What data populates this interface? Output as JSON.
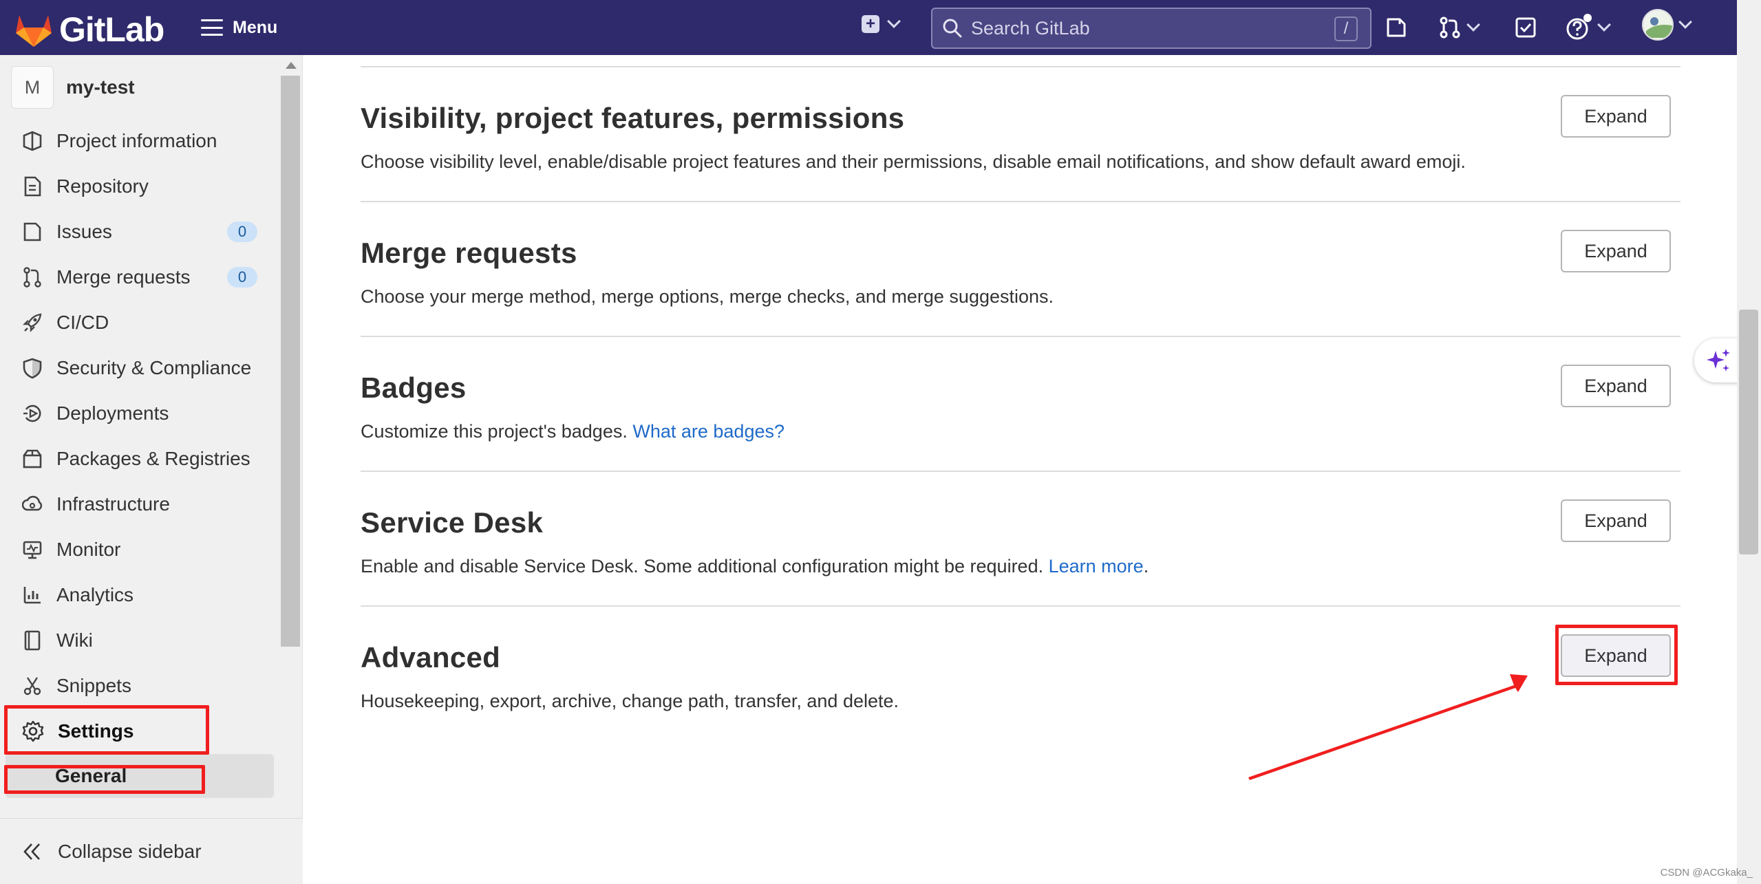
{
  "topbar": {
    "brand": "GitLab",
    "menu_label": "Menu",
    "search_placeholder": "Search GitLab",
    "search_shortcut": "/"
  },
  "sidebar": {
    "project_initial": "M",
    "project_name": "my-test",
    "items": [
      {
        "label": "Project information",
        "icon": "project-information-icon"
      },
      {
        "label": "Repository",
        "icon": "repository-icon"
      },
      {
        "label": "Issues",
        "icon": "issues-icon",
        "count": "0"
      },
      {
        "label": "Merge requests",
        "icon": "merge-requests-icon",
        "count": "0"
      },
      {
        "label": "CI/CD",
        "icon": "rocket-icon"
      },
      {
        "label": "Security & Compliance",
        "icon": "shield-icon"
      },
      {
        "label": "Deployments",
        "icon": "deployments-icon"
      },
      {
        "label": "Packages & Registries",
        "icon": "package-icon"
      },
      {
        "label": "Infrastructure",
        "icon": "infrastructure-icon"
      },
      {
        "label": "Monitor",
        "icon": "monitor-icon"
      },
      {
        "label": "Analytics",
        "icon": "analytics-icon"
      },
      {
        "label": "Wiki",
        "icon": "wiki-icon"
      },
      {
        "label": "Snippets",
        "icon": "snippets-icon"
      },
      {
        "label": "Settings",
        "icon": "gear-icon"
      }
    ],
    "sub_item": "General",
    "collapse_label": "Collapse sidebar"
  },
  "sections": [
    {
      "title": "Visibility, project features, permissions",
      "description": "Choose visibility level, enable/disable project features and their permissions, disable email notifications, and show default award emoji.",
      "button": "Expand"
    },
    {
      "title": "Merge requests",
      "description": "Choose your merge method, merge options, merge checks, and merge suggestions.",
      "button": "Expand"
    },
    {
      "title": "Badges",
      "description": "Customize this project's badges.",
      "link": "What are badges?",
      "button": "Expand"
    },
    {
      "title": "Service Desk",
      "description": "Enable and disable Service Desk. Some additional configuration might be required.",
      "link": "Learn more",
      "link_suffix": ".",
      "button": "Expand"
    },
    {
      "title": "Advanced",
      "description": "Housekeeping, export, archive, change path, transfer, and delete.",
      "button": "Expand"
    }
  ],
  "watermark": "CSDN @ACGkaka_",
  "colors": {
    "topbar": "#2f2a6b",
    "link": "#1f6ac9",
    "annotation": "#f01e1e",
    "badge_bg": "#cbe2f9"
  }
}
